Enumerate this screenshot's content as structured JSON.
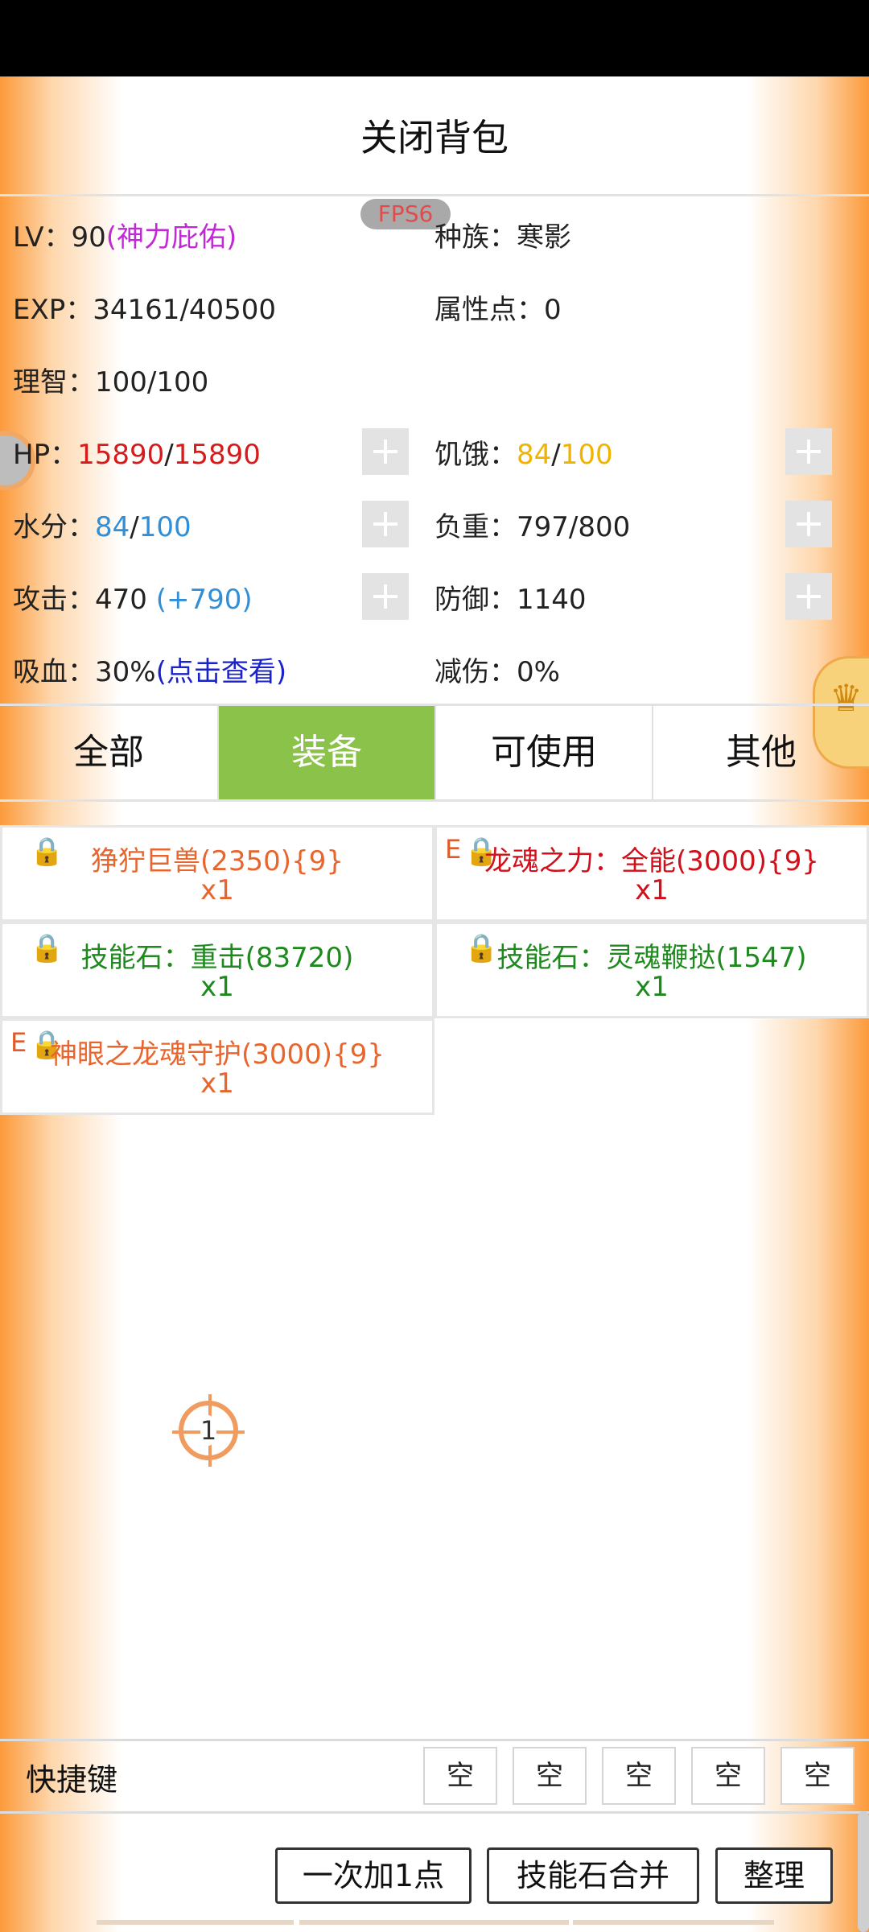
{
  "header": {
    "title": "关闭背包",
    "fps": "FPS6"
  },
  "stats": {
    "lv_label": "LV：",
    "lv_value": "90",
    "lv_bonus": "(神力庇佑)",
    "race_label": "种族：",
    "race_value": "寒影",
    "exp_label": "EXP：",
    "exp_value": "34161/40500",
    "attr_label": "属性点：",
    "attr_value": "0",
    "sanity_label": "理智：",
    "sanity_value": "100/100",
    "hp_label": "HP：",
    "hp_cur": "15890",
    "hp_sep": "/",
    "hp_max": "15890",
    "hunger_label": "饥饿：",
    "hunger_cur": "84",
    "hunger_sep": "/",
    "hunger_max": "100",
    "water_label": "水分：",
    "water_cur": "84",
    "water_sep": "/",
    "water_max": "100",
    "load_label": "负重：",
    "load_value": "797/800",
    "atk_label": "攻击：",
    "atk_value": "470 ",
    "atk_bonus": "(+790)",
    "def_label": "防御：",
    "def_value": "1140",
    "lifesteal_label": "吸血：",
    "lifesteal_value": "30%",
    "lifesteal_link": "(点击查看)",
    "dmgred_label": "减伤：",
    "dmgred_value": "0%"
  },
  "tabs": [
    "全部",
    "装备",
    "可使用",
    "其他"
  ],
  "active_tab": "装备",
  "items": [
    {
      "name": "狰狞巨兽(2350){9}",
      "count": "x1",
      "prefix": ""
    },
    {
      "name": "龙魂之力：全能(3000){9}",
      "count": "x1",
      "prefix": "E"
    },
    {
      "name": "技能石：重击(83720)",
      "count": "x1",
      "prefix": ""
    },
    {
      "name": "技能石：灵魂鞭挞(1547)",
      "count": "x1",
      "prefix": ""
    },
    {
      "name": "神眼之龙魂守护(3000){9}",
      "count": "x1",
      "prefix": "E"
    }
  ],
  "marker": {
    "label": "1"
  },
  "shortcuts": {
    "label": "快捷键",
    "slots": [
      "空",
      "空",
      "空",
      "空",
      "空"
    ]
  },
  "buttons": {
    "add_one": "一次加1点",
    "merge": "技能石合并",
    "sort": "整理"
  },
  "icons": {
    "lock": "🔒"
  },
  "colors": {
    "accent_green": "#8bc34a",
    "edge_orange": "#fb9a3a"
  }
}
